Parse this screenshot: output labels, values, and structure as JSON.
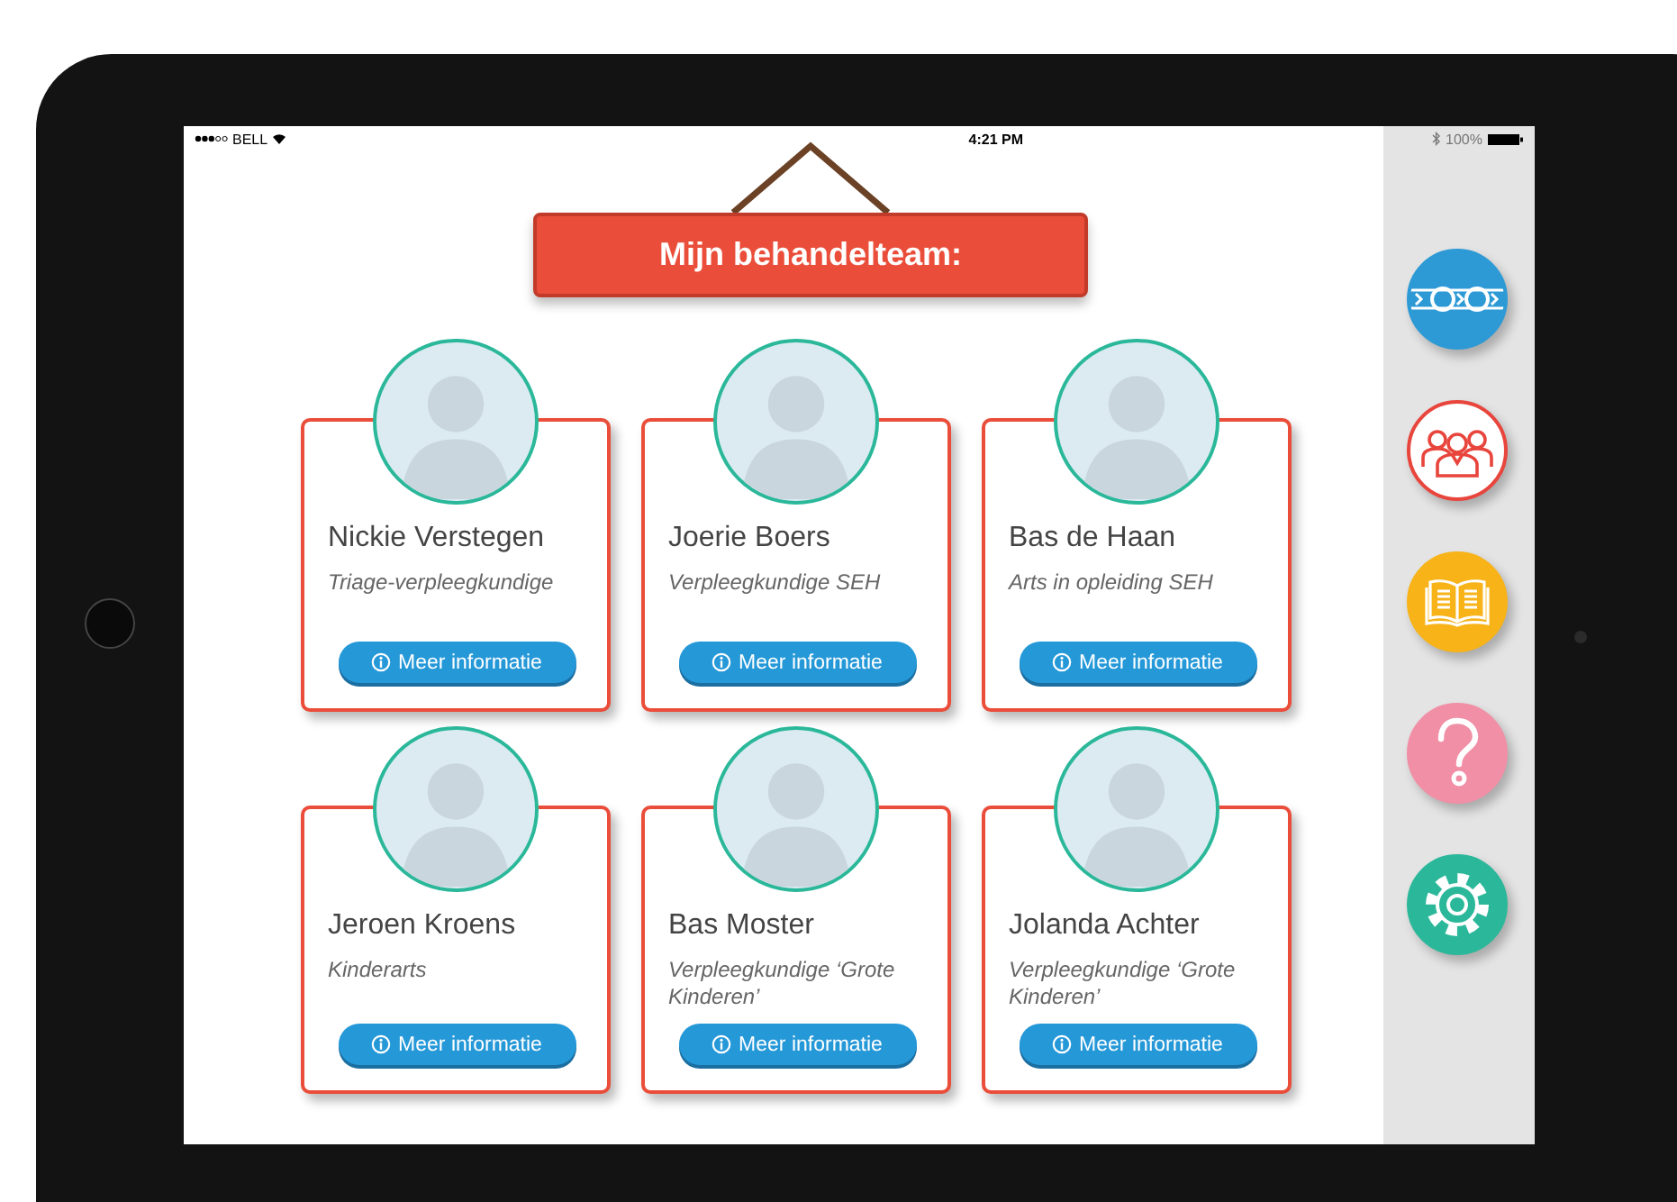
{
  "status_bar": {
    "carrier": "BELL",
    "time": "4:21 PM",
    "battery": "100%"
  },
  "header": {
    "title": "Mijn behandelteam:"
  },
  "team_members": [
    {
      "name": "Nickie Verstegen",
      "role": "Triage-verpleegkundige",
      "button": "Meer informatie"
    },
    {
      "name": "Joerie Boers",
      "role": "Verpleegkundige SEH",
      "button": "Meer informatie"
    },
    {
      "name": "Bas de Haan",
      "role": "Arts in opleiding SEH",
      "button": "Meer informatie"
    },
    {
      "name": "Jeroen Kroens",
      "role": "Kinderarts",
      "button": "Meer informatie"
    },
    {
      "name": "Bas Moster",
      "role": "Verpleegkundige ‘Grote Kinderen’",
      "button": "Meer informatie"
    },
    {
      "name": "Jolanda Achter",
      "role": "Verpleegkundige ‘Grote Kinderen’",
      "button": "Meer informatie"
    }
  ],
  "sidebar": {
    "items": [
      {
        "kind": "journey",
        "color": "#2d9ad6",
        "selected": false
      },
      {
        "kind": "team",
        "color": "#e8453c",
        "selected": true
      },
      {
        "kind": "book",
        "color": "#f7b318",
        "selected": false
      },
      {
        "kind": "help",
        "color": "#f18fa6",
        "selected": false
      },
      {
        "kind": "settings",
        "color": "#2bb89a",
        "selected": false
      }
    ]
  }
}
